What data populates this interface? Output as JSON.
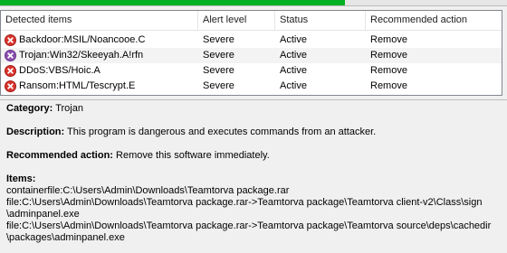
{
  "progress": {
    "percent": 68,
    "color": "#06b025"
  },
  "table": {
    "columns": [
      "Detected items",
      "Alert level",
      "Status",
      "Recommended action"
    ],
    "rows": [
      {
        "name": "Backdoor:MSIL/Noancooe.C",
        "alert": "Severe",
        "status": "Active",
        "action": "Remove",
        "icon": "red-x-circle-icon",
        "icon_color": "#d9322b"
      },
      {
        "name": "Trojan:Win32/Skeeyah.A!rfn",
        "alert": "Severe",
        "status": "Active",
        "action": "Remove",
        "icon": "purple-x-circle-icon",
        "icon_color": "#8a4fb0"
      },
      {
        "name": "DDoS:VBS/Hoic.A",
        "alert": "Severe",
        "status": "Active",
        "action": "Remove",
        "icon": "red-x-circle-icon",
        "icon_color": "#d9322b"
      },
      {
        "name": "Ransom:HTML/Tescrypt.E",
        "alert": "Severe",
        "status": "Active",
        "action": "Remove",
        "icon": "red-x-circle-icon",
        "icon_color": "#d9322b"
      }
    ]
  },
  "details": {
    "category_label": "Category:",
    "category_value": "Trojan",
    "description_label": "Description:",
    "description_value": "This program is dangerous and executes commands from an attacker.",
    "action_label": "Recommended action:",
    "action_value": "Remove this software immediately.",
    "items_label": "Items:",
    "items_lines": [
      "containerfile:C:\\Users\\Admin\\Downloads\\Teamtorva package.rar",
      "file:C:\\Users\\Admin\\Downloads\\Teamtorva package.rar->Teamtorva package\\Teamtorva client-v2\\Class\\sign",
      "\\adminpanel.exe",
      "file:C:\\Users\\Admin\\Downloads\\Teamtorva package.rar->Teamtorva package\\Teamtorva source\\deps\\cachedir",
      "\\packages\\adminpanel.exe"
    ]
  }
}
